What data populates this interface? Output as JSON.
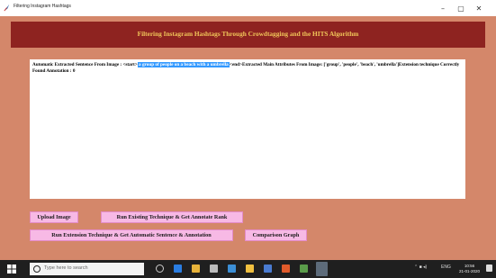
{
  "window": {
    "title": "Filtering Instagram Hashtags",
    "minimize": "–",
    "maximize": "▢",
    "close": "✕"
  },
  "header": {
    "title": "Filtering Instagram Hashtags Through Crowdtagging and the HITS Algorithm"
  },
  "output": {
    "prefix": "Automatic Extracted Sentence From Image : <start>",
    "selected": " a group of people on a beach with a umbrella ",
    "suffix": "<end>Extracted Main Attributes From Image: ['group', 'people', 'beach', 'umbrella']Extension technique Correctly Found Annotation : 0"
  },
  "buttons": {
    "upload": "Upload Image",
    "run_existing": "Run Existing Technique & Get Annotate Rank",
    "run_extension": "Run Extension Technique & Get Automatic Sentence & Annotation",
    "comparison": "Comparison Graph"
  },
  "taskbar": {
    "search_placeholder": "Type here to search",
    "time": "10:56",
    "date": "21-01-2020",
    "tray_text": "ENG"
  },
  "colors": {
    "background": "#d4876a",
    "header_bg": "#8e2320",
    "header_text": "#f1c75a",
    "button_bg": "#f7b9e5",
    "selection": "#3399ff"
  }
}
